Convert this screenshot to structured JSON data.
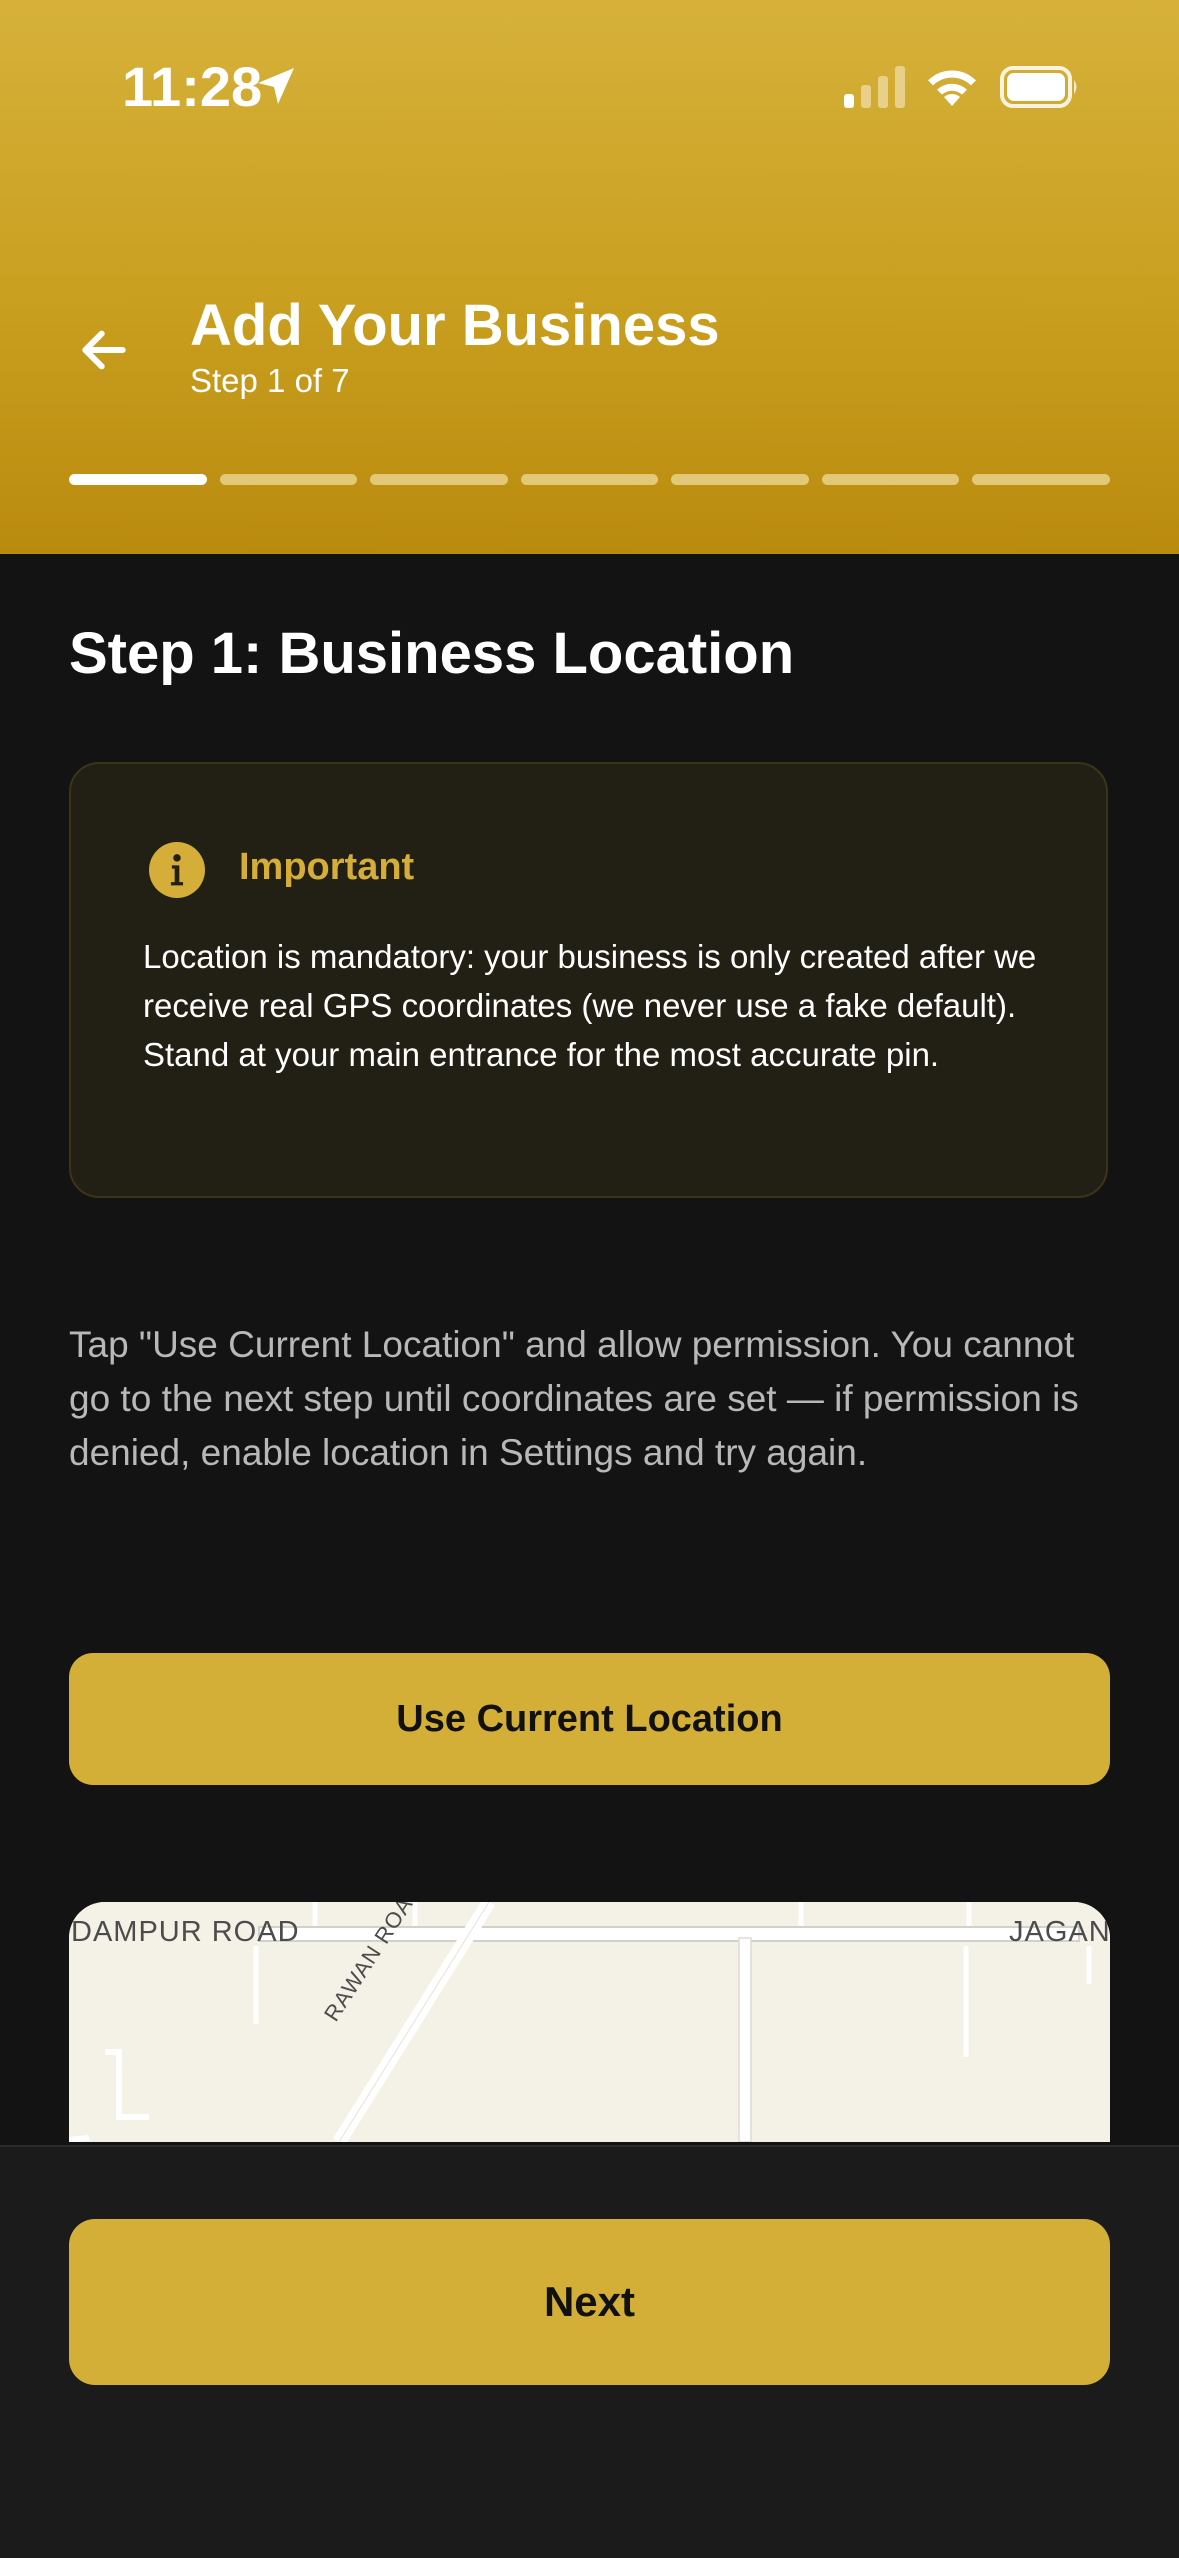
{
  "status_bar": {
    "time": "11:28",
    "icons": [
      "location-arrow-icon",
      "cellular-signal-icon",
      "wifi-icon",
      "battery-icon"
    ]
  },
  "header": {
    "title": "Add Your Business",
    "subtitle": "Step 1 of 7",
    "back_icon": "arrow-left-icon",
    "progress": {
      "current_step": 1,
      "total_steps": 7
    }
  },
  "step": {
    "heading": "Step 1: Business Location"
  },
  "info_card": {
    "icon": "info-icon",
    "title": "Important",
    "body": "Location is mandatory: your business is only created after we receive real GPS coordinates (we never use a fake default). Stand at your main entrance for the most accurate pin."
  },
  "instructions": "Tap \"Use Current Location\" and allow permission. You cannot go to the next step until coordinates are set — if permission is denied, enable location in Settings and try again.",
  "use_location_button": {
    "label": "Use Current Location"
  },
  "map": {
    "labels": {
      "top_left": "DAMPUR ROAD",
      "top_right": "JAGAN",
      "road": "RAWAN ROAD"
    }
  },
  "footer": {
    "next_label": "Next"
  },
  "colors": {
    "accent": "#d4af37",
    "header_gradient_top": "#d6b13a",
    "header_gradient_bottom": "#b98a0e",
    "background": "#131313",
    "card_background": "#221f15",
    "progress_active": "#ffffff",
    "progress_inactive": "#e3c977"
  }
}
